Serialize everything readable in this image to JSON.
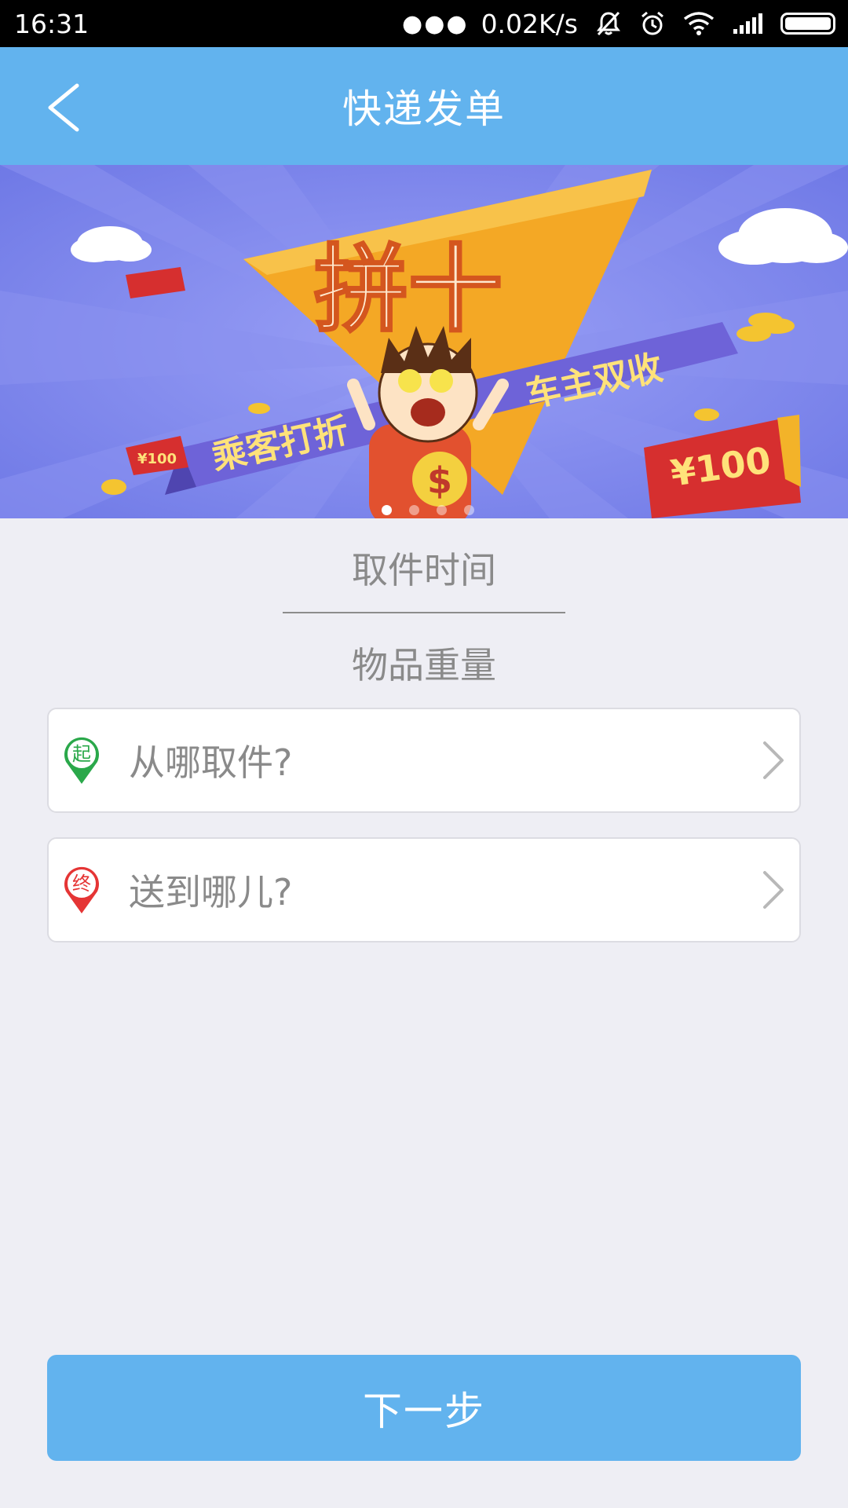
{
  "status_bar": {
    "time": "16:31",
    "network_speed": "0.02K/s",
    "icons": [
      "more-dots-icon",
      "mute-vibrate-icon",
      "alarm-icon",
      "wifi-icon",
      "signal-icon",
      "battery-icon"
    ]
  },
  "app_bar": {
    "title": "快递发单",
    "back_icon": "back-arrow-icon"
  },
  "banner": {
    "headline": "拼十",
    "ribbon_left": "乘客打折",
    "ribbon_right": "车主双收",
    "red_packet_small": "¥100",
    "red_packet_large": "¥100",
    "slide_count": 4,
    "active_slide": 1
  },
  "form": {
    "pickup_time_label": "取件时间",
    "item_weight_label": "物品重量",
    "from_badge": "起",
    "from_placeholder": "从哪取件?",
    "to_badge": "终",
    "to_placeholder": "送到哪儿?"
  },
  "footer": {
    "next_label": "下一步"
  },
  "colors": {
    "primary": "#62b3ee",
    "background": "#eeeef4",
    "start_pin": "#2aa84a",
    "end_pin": "#e53535",
    "muted_text": "#8a8a8a"
  }
}
